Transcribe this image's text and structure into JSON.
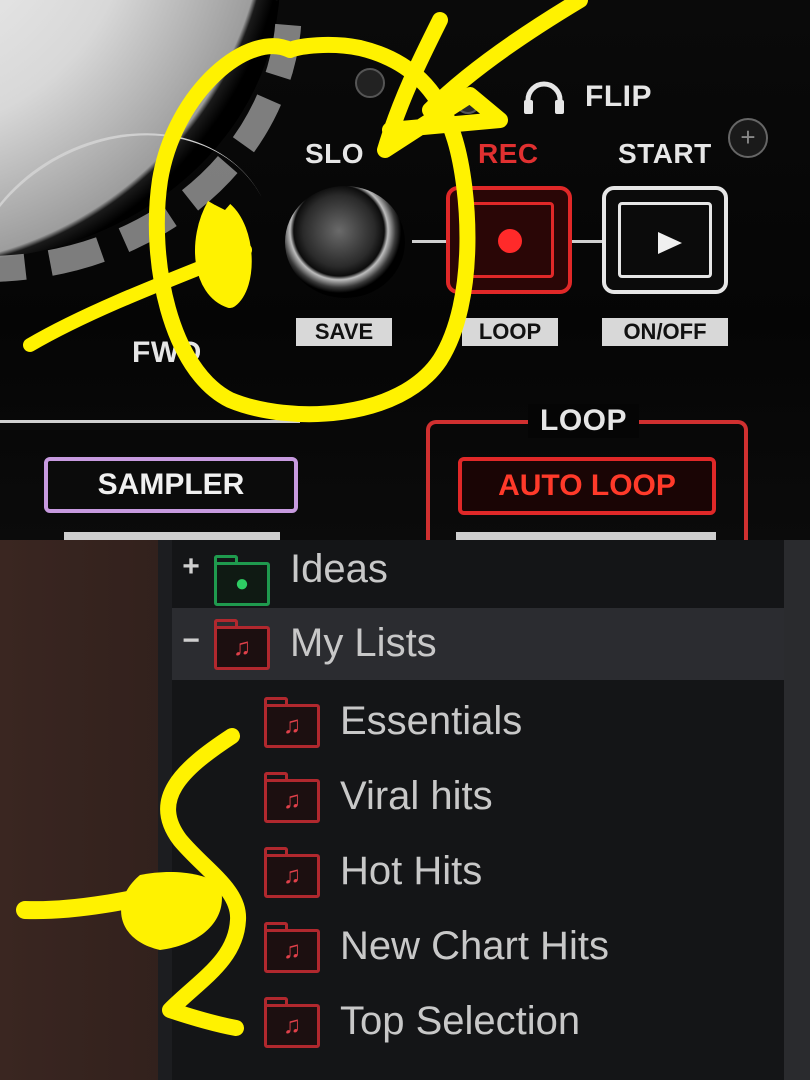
{
  "controller": {
    "labels": {
      "flip": "FLIP",
      "slip": "SLO",
      "rec": "REC",
      "start": "START",
      "fwd": "FWD",
      "save": "SAVE",
      "loop_sub": "LOOP",
      "onoff": "ON/OFF",
      "loop_section": "LOOP",
      "sampler": "SAMPLER",
      "auto_loop": "AUTO LOOP"
    },
    "colors": {
      "rec_red": "#e02828",
      "sampler_purple": "#c79adf",
      "label_white": "#e6e6e6"
    },
    "icons": {
      "flip": "headphones-icon",
      "rec": "record-dot-icon",
      "start": "play-icon"
    }
  },
  "tree": {
    "items": [
      {
        "label": "Ideas",
        "toggle": "+",
        "icon": "lightbulb-folder-icon",
        "color": "#1f9a4e",
        "selected": false
      },
      {
        "label": "My Lists",
        "toggle": "−",
        "icon": "playlist-folder-icon",
        "color": "#b1282e",
        "selected": true
      },
      {
        "label": "Essentials",
        "icon": "playlist-folder-icon",
        "color": "#b1282e"
      },
      {
        "label": "Viral hits",
        "icon": "playlist-folder-icon",
        "color": "#b1282e"
      },
      {
        "label": "Hot Hits",
        "icon": "playlist-folder-icon",
        "color": "#b1282e"
      },
      {
        "label": "New Chart Hits",
        "icon": "playlist-folder-icon",
        "color": "#b1282e"
      },
      {
        "label": "Top Selection",
        "icon": "playlist-folder-icon",
        "color": "#b1282e"
      }
    ]
  },
  "annotation": {
    "color": "#fff200"
  }
}
